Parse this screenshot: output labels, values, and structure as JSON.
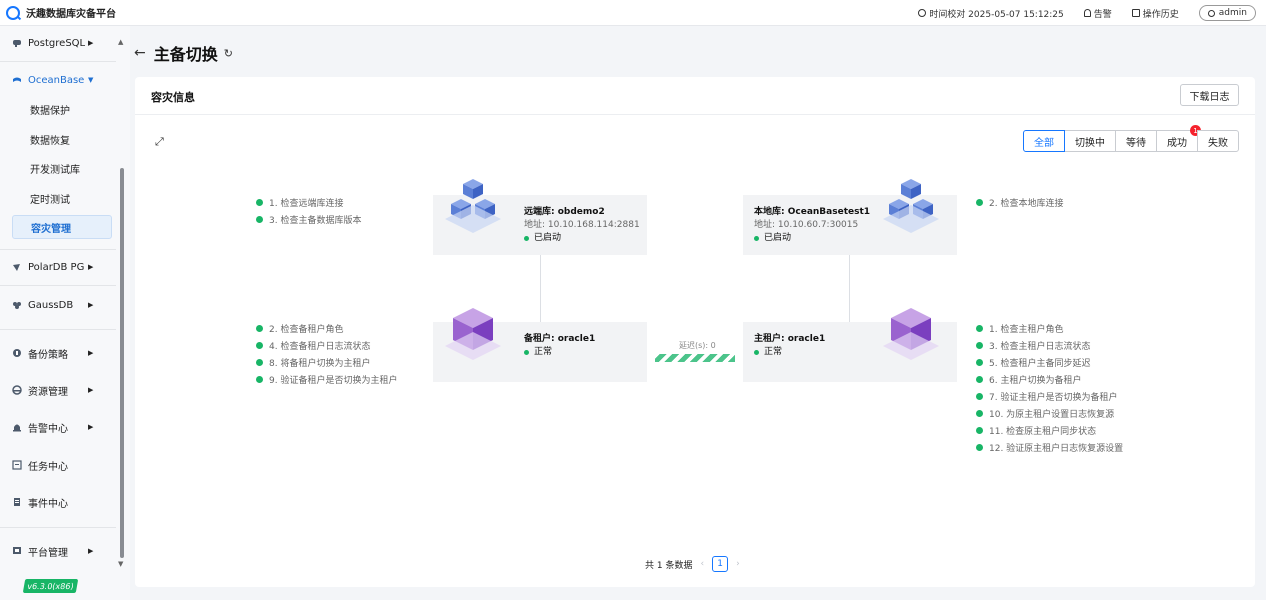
{
  "app": {
    "title": "沃趣数据库灾备平台"
  },
  "topbar": {
    "time_sync": "时间校对 2025-05-07 15:12:25",
    "alert": "告警",
    "history": "操作历史",
    "user": "admin"
  },
  "sidebar": {
    "postgresql": "PostgreSQL",
    "oceanbase": "OceanBase",
    "ob_sub": [
      "数据保护",
      "数据恢复",
      "开发测试库",
      "定时测试",
      "容灾管理"
    ],
    "polardb": "PolarDB PG",
    "gaussdb": "GaussDB",
    "backup_policy": "备份策略",
    "resource_mgmt": "资源管理",
    "alert_center": "告警中心",
    "task_center": "任务中心",
    "event_center": "事件中心",
    "platform_mgmt": "平台管理",
    "version": "v6.3.0(x86)"
  },
  "page": {
    "title": "主备切换"
  },
  "card": {
    "title": "容灾信息",
    "download": "下载日志",
    "filters": [
      "全部",
      "切换中",
      "等待",
      "成功",
      "失败"
    ],
    "success_badge": "1"
  },
  "diagram": {
    "remote": {
      "name": "远端库: obdemo2",
      "addr": "地址: 10.10.168.114:2881",
      "status": "已启动"
    },
    "local": {
      "name": "本地库: OceanBasetest1",
      "addr": "地址: 10.10.60.7:30015",
      "status": "已启动"
    },
    "standby": {
      "name": "备租户: oracle1",
      "status": "正常"
    },
    "primary": {
      "name": "主租户: oracle1",
      "status": "正常"
    },
    "delay": "延迟(s): 0",
    "steps_remote": [
      "1. 检查远端库连接",
      "3. 检查主备数据库版本"
    ],
    "steps_local": [
      "2. 检查本地库连接"
    ],
    "steps_standby": [
      "2. 检查备租户角色",
      "4. 检查备租户日志流状态",
      "8. 将备租户切换为主租户",
      "9. 验证备租户是否切换为主租户"
    ],
    "steps_primary": [
      "1. 检查主租户角色",
      "3. 检查主租户日志流状态",
      "5. 检查租户主备同步延迟",
      "6. 主租户切换为备租户",
      "7. 验证主租户是否切换为备租户",
      "10. 为原主租户设置日志恢复源",
      "11. 检查原主租户同步状态",
      "12. 验证原主租户日志恢复源设置"
    ]
  },
  "pager": {
    "total": "共 1 条数据",
    "current": "1"
  }
}
